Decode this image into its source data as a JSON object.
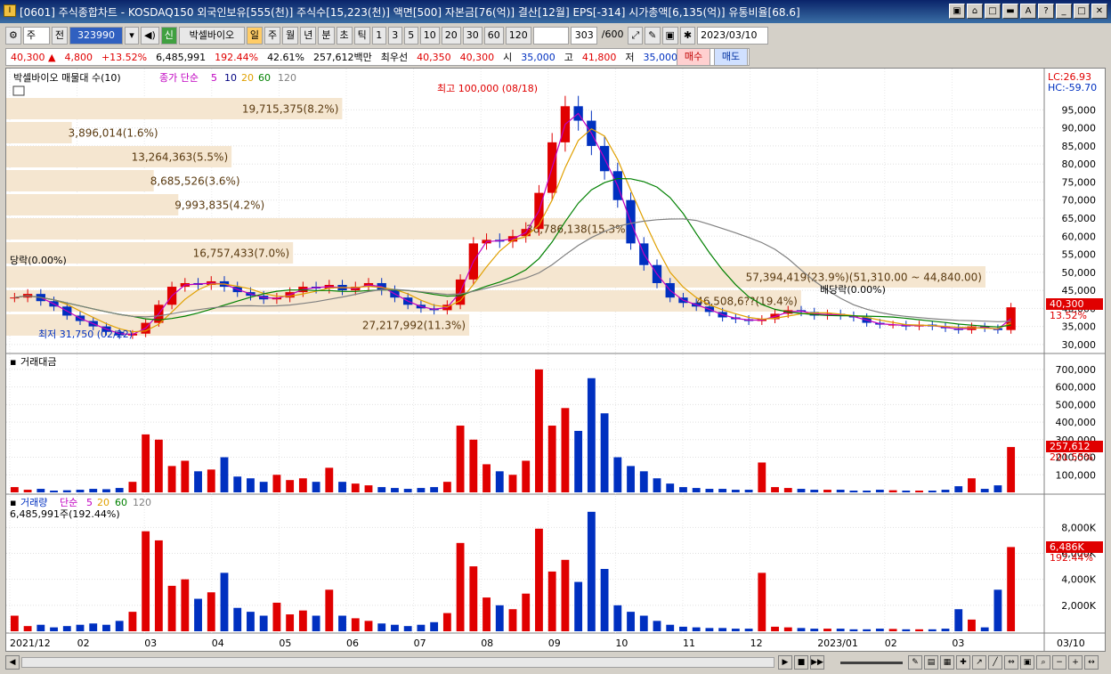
{
  "window": {
    "title": "[0601] 주식종합차트 - KOSDAQ150 외국인보유[555(천)] 주식수[15,223(천)] 액면[500] 자본금[76(억)] 결산[12월] EPS[-314] 시가총액[6,135(억)] 유통비율[68.6]",
    "icon_label": "I",
    "buttons": [
      "▣",
      "⌂",
      "□",
      "▬",
      "A",
      "?",
      "_",
      "□",
      "✕"
    ]
  },
  "toolbar": {
    "period_select": "주",
    "prev_label": "전",
    "code_value": "323990",
    "stock_badge": "신",
    "stock_name": "박셀바이오",
    "period_buttons": [
      "일",
      "주",
      "월",
      "년",
      "분",
      "초",
      "틱"
    ],
    "active_period": "일",
    "intervals": [
      "1",
      "3",
      "5",
      "10",
      "20",
      "30",
      "60",
      "120"
    ],
    "count_value": "303",
    "count_total": "/600",
    "date_value": "2023/03/10"
  },
  "quote": {
    "price": "40,300 ▲",
    "change": "4,800",
    "rate": "+13.52%",
    "volume": "6,485,991",
    "vol_rate": "192.44%",
    "turnover": "42.61%",
    "amount": "257,612백만",
    "best_ask_label": "최우선",
    "ask": "40,350",
    "bid": "40,300",
    "open_label": "시",
    "open": "35,000",
    "high_label": "고",
    "high": "41,800",
    "low_label": "저",
    "low": "35,000",
    "buy_label": "매수",
    "sell_label": "매도"
  },
  "panels": {
    "price": {
      "legend_name": "박셀바이오 매물대 수(10)",
      "ma_label": "종가 단순",
      "ma_periods": [
        "5",
        "10",
        "20",
        "60",
        "120"
      ],
      "lc": "LC:26.93",
      "hc": "HC:-59.70",
      "y_ticks": [
        "95,000",
        "90,000",
        "85,000",
        "80,000",
        "75,000",
        "70,000",
        "65,000",
        "60,000",
        "55,000",
        "50,000",
        "45,000",
        "40,000",
        "35,000",
        "30,000"
      ],
      "current_price_tag": "40,300",
      "current_rate_tag": "13.52%",
      "annotations": {
        "high": "최고 100,000 (08/18)",
        "low": "최저 31,750 (02/22)",
        "drop_left": "당락(0.00%)",
        "drop_right": "배당락(0.00%)"
      },
      "volume_profile": [
        {
          "label": "19,715,375(8.2%)",
          "fraction": 0.082
        },
        {
          "label": "3,896,014(1.6%)",
          "fraction": 0.016
        },
        {
          "label": "13,264,363(5.5%)",
          "fraction": 0.055
        },
        {
          "label": "8,685,526(3.6%)",
          "fraction": 0.036
        },
        {
          "label": "9,993,835(4.2%)",
          "fraction": 0.042
        },
        {
          "label": "36,786,138(15.3%)",
          "fraction": 0.153
        },
        {
          "label": "16,757,433(7.0%)",
          "fraction": 0.07
        },
        {
          "label": "57,394,419(23.9%)(51,310.00 ~ 44,840.00)",
          "fraction": 0.239
        },
        {
          "label": "46,508,6??(19.4%)",
          "fraction": 0.194
        },
        {
          "label": "27,217,992(11.3%)",
          "fraction": 0.113
        }
      ]
    },
    "amount": {
      "legend": "거래대금",
      "y_ticks": [
        "700,000",
        "600,000",
        "500,000",
        "400,000",
        "300,000",
        "200,000",
        "100,000"
      ],
      "last_tag": "257,612",
      "rate_tag": "201.55%"
    },
    "volume": {
      "legend": "거래량",
      "ma_label": "단순",
      "ma_periods": [
        "5",
        "20",
        "60",
        "120"
      ],
      "value_line": "6,485,991주(192.44%)",
      "y_ticks": [
        "8,000K",
        "6,000K",
        "4,000K",
        "2,000K"
      ],
      "last_tag": "6,486K",
      "rate_tag": "192.44%"
    }
  },
  "x_axis": [
    "2021/12",
    "02",
    "03",
    "04",
    "05",
    "06",
    "07",
    "08",
    "09",
    "10",
    "11",
    "12",
    "2023/01",
    "02",
    "03"
  ],
  "x_end_label": "03/10",
  "colors": {
    "up": "#e00000",
    "down": "#0030c0",
    "profile": "#f5e6d0",
    "ma5": "#c000c0",
    "ma10": "#000080",
    "ma20": "#e0a000",
    "ma60": "#008000",
    "ma120": "#808080"
  },
  "chart_data": {
    "type": "candlestick",
    "y_range": [
      28000,
      102000
    ],
    "high": 100000,
    "low": 31750,
    "last_close": 40300,
    "months": [
      "2021/12",
      "02",
      "03",
      "04",
      "05",
      "06",
      "07",
      "08",
      "09",
      "10",
      "11",
      "12",
      "2023/01",
      "02",
      "03"
    ],
    "close_trace": [
      43000,
      44000,
      42000,
      40500,
      38000,
      36500,
      35000,
      33500,
      32500,
      33000,
      36000,
      41000,
      46000,
      47000,
      46500,
      47500,
      46000,
      44500,
      43500,
      42500,
      43000,
      44500,
      46000,
      45500,
      46500,
      45000,
      46000,
      47000,
      45000,
      43000,
      41000,
      40000,
      39500,
      41000,
      48000,
      58000,
      59000,
      58500,
      60000,
      62000,
      72000,
      86000,
      96000,
      92000,
      85000,
      78000,
      70000,
      58000,
      52000,
      47000,
      43000,
      41500,
      40500,
      39000,
      37500,
      37000,
      36500,
      37000,
      38500,
      39500,
      39000,
      38000,
      38500,
      38000,
      37500,
      36000,
      35500,
      35500,
      35000,
      35500,
      35000,
      34500,
      34000,
      35000,
      34500,
      34000,
      40300
    ],
    "amount_trace": [
      30,
      15,
      20,
      10,
      12,
      15,
      20,
      18,
      25,
      60,
      330,
      300,
      150,
      180,
      120,
      130,
      200,
      90,
      80,
      60,
      100,
      70,
      80,
      60,
      140,
      60,
      50,
      40,
      30,
      25,
      20,
      25,
      30,
      60,
      380,
      300,
      160,
      120,
      100,
      180,
      700,
      380,
      480,
      350,
      650,
      450,
      200,
      150,
      120,
      80,
      50,
      30,
      25,
      20,
      20,
      15,
      15,
      170,
      30,
      25,
      20,
      15,
      15,
      15,
      10,
      10,
      15,
      12,
      10,
      10,
      10,
      15,
      35,
      80,
      20,
      40,
      258
    ],
    "volume_trace": [
      1200,
      400,
      500,
      300,
      400,
      500,
      600,
      500,
      800,
      1500,
      7700,
      7000,
      3500,
      4000,
      2500,
      3000,
      4500,
      1800,
      1500,
      1200,
      2200,
      1300,
      1600,
      1200,
      3200,
      1200,
      1000,
      800,
      600,
      500,
      400,
      500,
      700,
      1400,
      6800,
      5000,
      2600,
      2000,
      1700,
      2900,
      7900,
      4600,
      5500,
      3800,
      9200,
      4800,
      2000,
      1500,
      1200,
      800,
      500,
      350,
      300,
      250,
      250,
      200,
      200,
      4500,
      350,
      300,
      250,
      200,
      200,
      200,
      150,
      150,
      200,
      180,
      150,
      150,
      150,
      200,
      1700,
      900,
      300,
      3200,
      6486
    ]
  }
}
